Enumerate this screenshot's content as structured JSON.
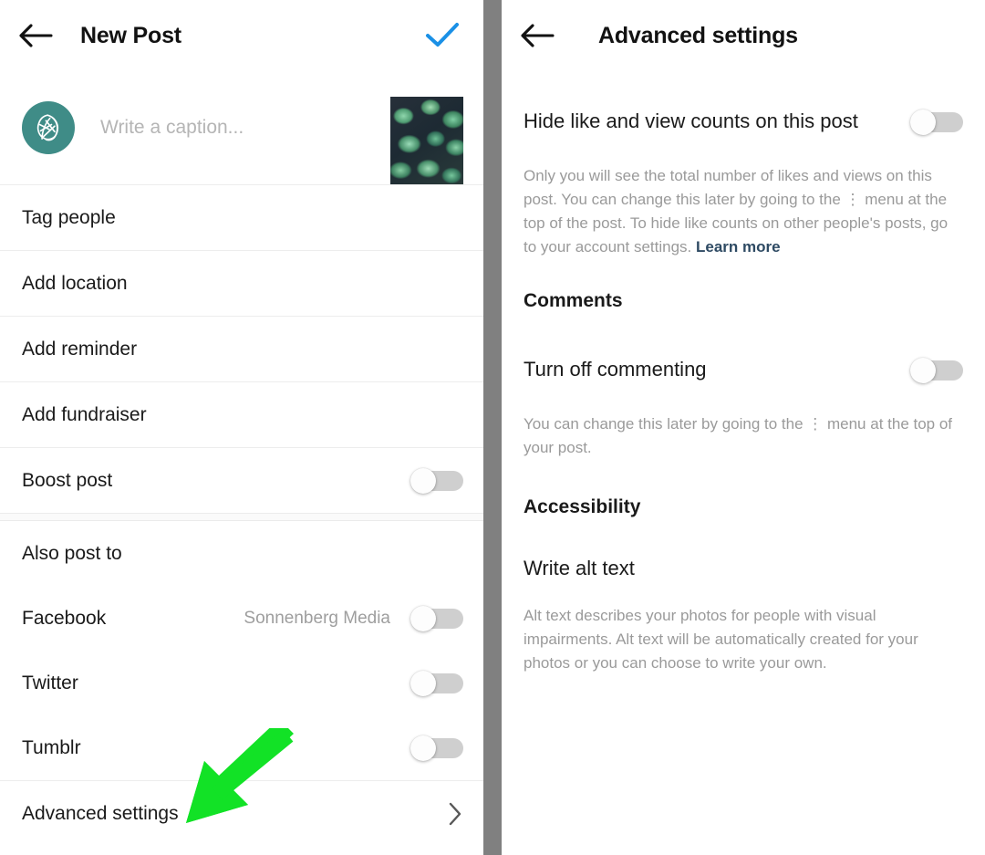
{
  "left_panel": {
    "header": {
      "back_icon": "back-arrow-icon",
      "title": "New Post",
      "confirm_icon": "checkmark-icon",
      "confirm_color": "#1a90e6"
    },
    "composer": {
      "avatar_icon": "leaf-logo-avatar",
      "avatar_color": "#3f8c87",
      "caption_placeholder": "Write a caption...",
      "thumbnail_alt": "succulent-plants-photo"
    },
    "options": [
      {
        "label": "Tag people",
        "type": "link"
      },
      {
        "label": "Add location",
        "type": "link"
      },
      {
        "label": "Add reminder",
        "type": "link"
      },
      {
        "label": "Add fundraiser",
        "type": "link"
      },
      {
        "label": "Boost post",
        "type": "toggle",
        "value": "off"
      }
    ],
    "also_post_to": {
      "heading": "Also post to",
      "items": [
        {
          "label": "Facebook",
          "detail": "Sonnenberg Media",
          "value": "off"
        },
        {
          "label": "Twitter",
          "detail": "",
          "value": "off"
        },
        {
          "label": "Tumblr",
          "detail": "",
          "value": "off"
        }
      ]
    },
    "advanced_settings": {
      "label": "Advanced settings",
      "chevron_icon": "chevron-right-icon"
    }
  },
  "right_panel": {
    "header": {
      "back_icon": "back-arrow-icon",
      "title": "Advanced settings"
    },
    "hide_counts": {
      "label": "Hide like and view counts on this post",
      "value": "off",
      "help_text": "Only you will see the total number of likes and views on this post. You can change this later by going to the ⋮ menu at the top of the post. To hide like counts on other people's posts, go to your account settings. ",
      "link_label": "Learn more"
    },
    "comments": {
      "heading": "Comments",
      "toggle_label": "Turn off commenting",
      "value": "off",
      "help_text": "You can change this later by going to the ⋮ menu at the top of your post."
    },
    "accessibility": {
      "heading": "Accessibility",
      "link_label": "Write alt text",
      "help_text": "Alt text describes your photos for people with visual impairments. Alt text will be automatically created for your photos or you can choose to write your own."
    }
  },
  "annotations": {
    "color": "#12e226",
    "arrows": [
      {
        "name": "arrow-pointing-to-advanced-settings",
        "target": "Advanced settings"
      },
      {
        "name": "arrow-pointing-to-write-alt-text",
        "target": "Write alt text"
      }
    ]
  }
}
